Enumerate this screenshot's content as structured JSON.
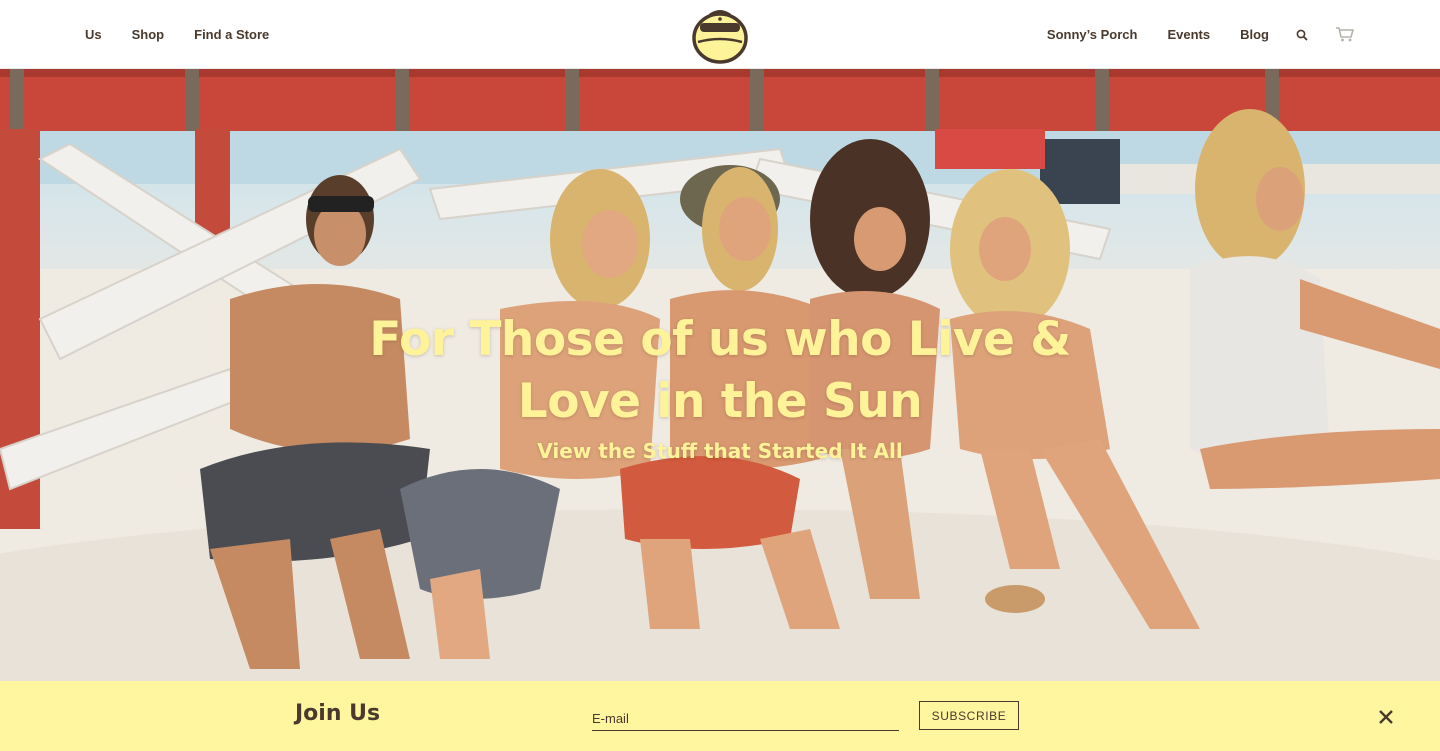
{
  "nav": {
    "left": [
      {
        "label": "Us"
      },
      {
        "label": "Shop"
      },
      {
        "label": "Find a Store"
      }
    ],
    "right": [
      {
        "label": "Sonny’s Porch"
      },
      {
        "label": "Events"
      },
      {
        "label": "Blog"
      }
    ],
    "icons": [
      "search-icon",
      "cart-icon"
    ]
  },
  "hero": {
    "title_line1": "For Those of us who Live &",
    "title_line2": "Love in the Sun",
    "subtitle": "View the Stuff that Started It All"
  },
  "join": {
    "title": "Join Us",
    "email_placeholder": "E-mail",
    "subscribe_label": "SUBSCRIBE"
  },
  "colors": {
    "brand_yellow": "#fff69f",
    "hero_text": "#fff39a",
    "text_dark": "#4a3a2e",
    "lifeguard_red": "#c9473a"
  }
}
